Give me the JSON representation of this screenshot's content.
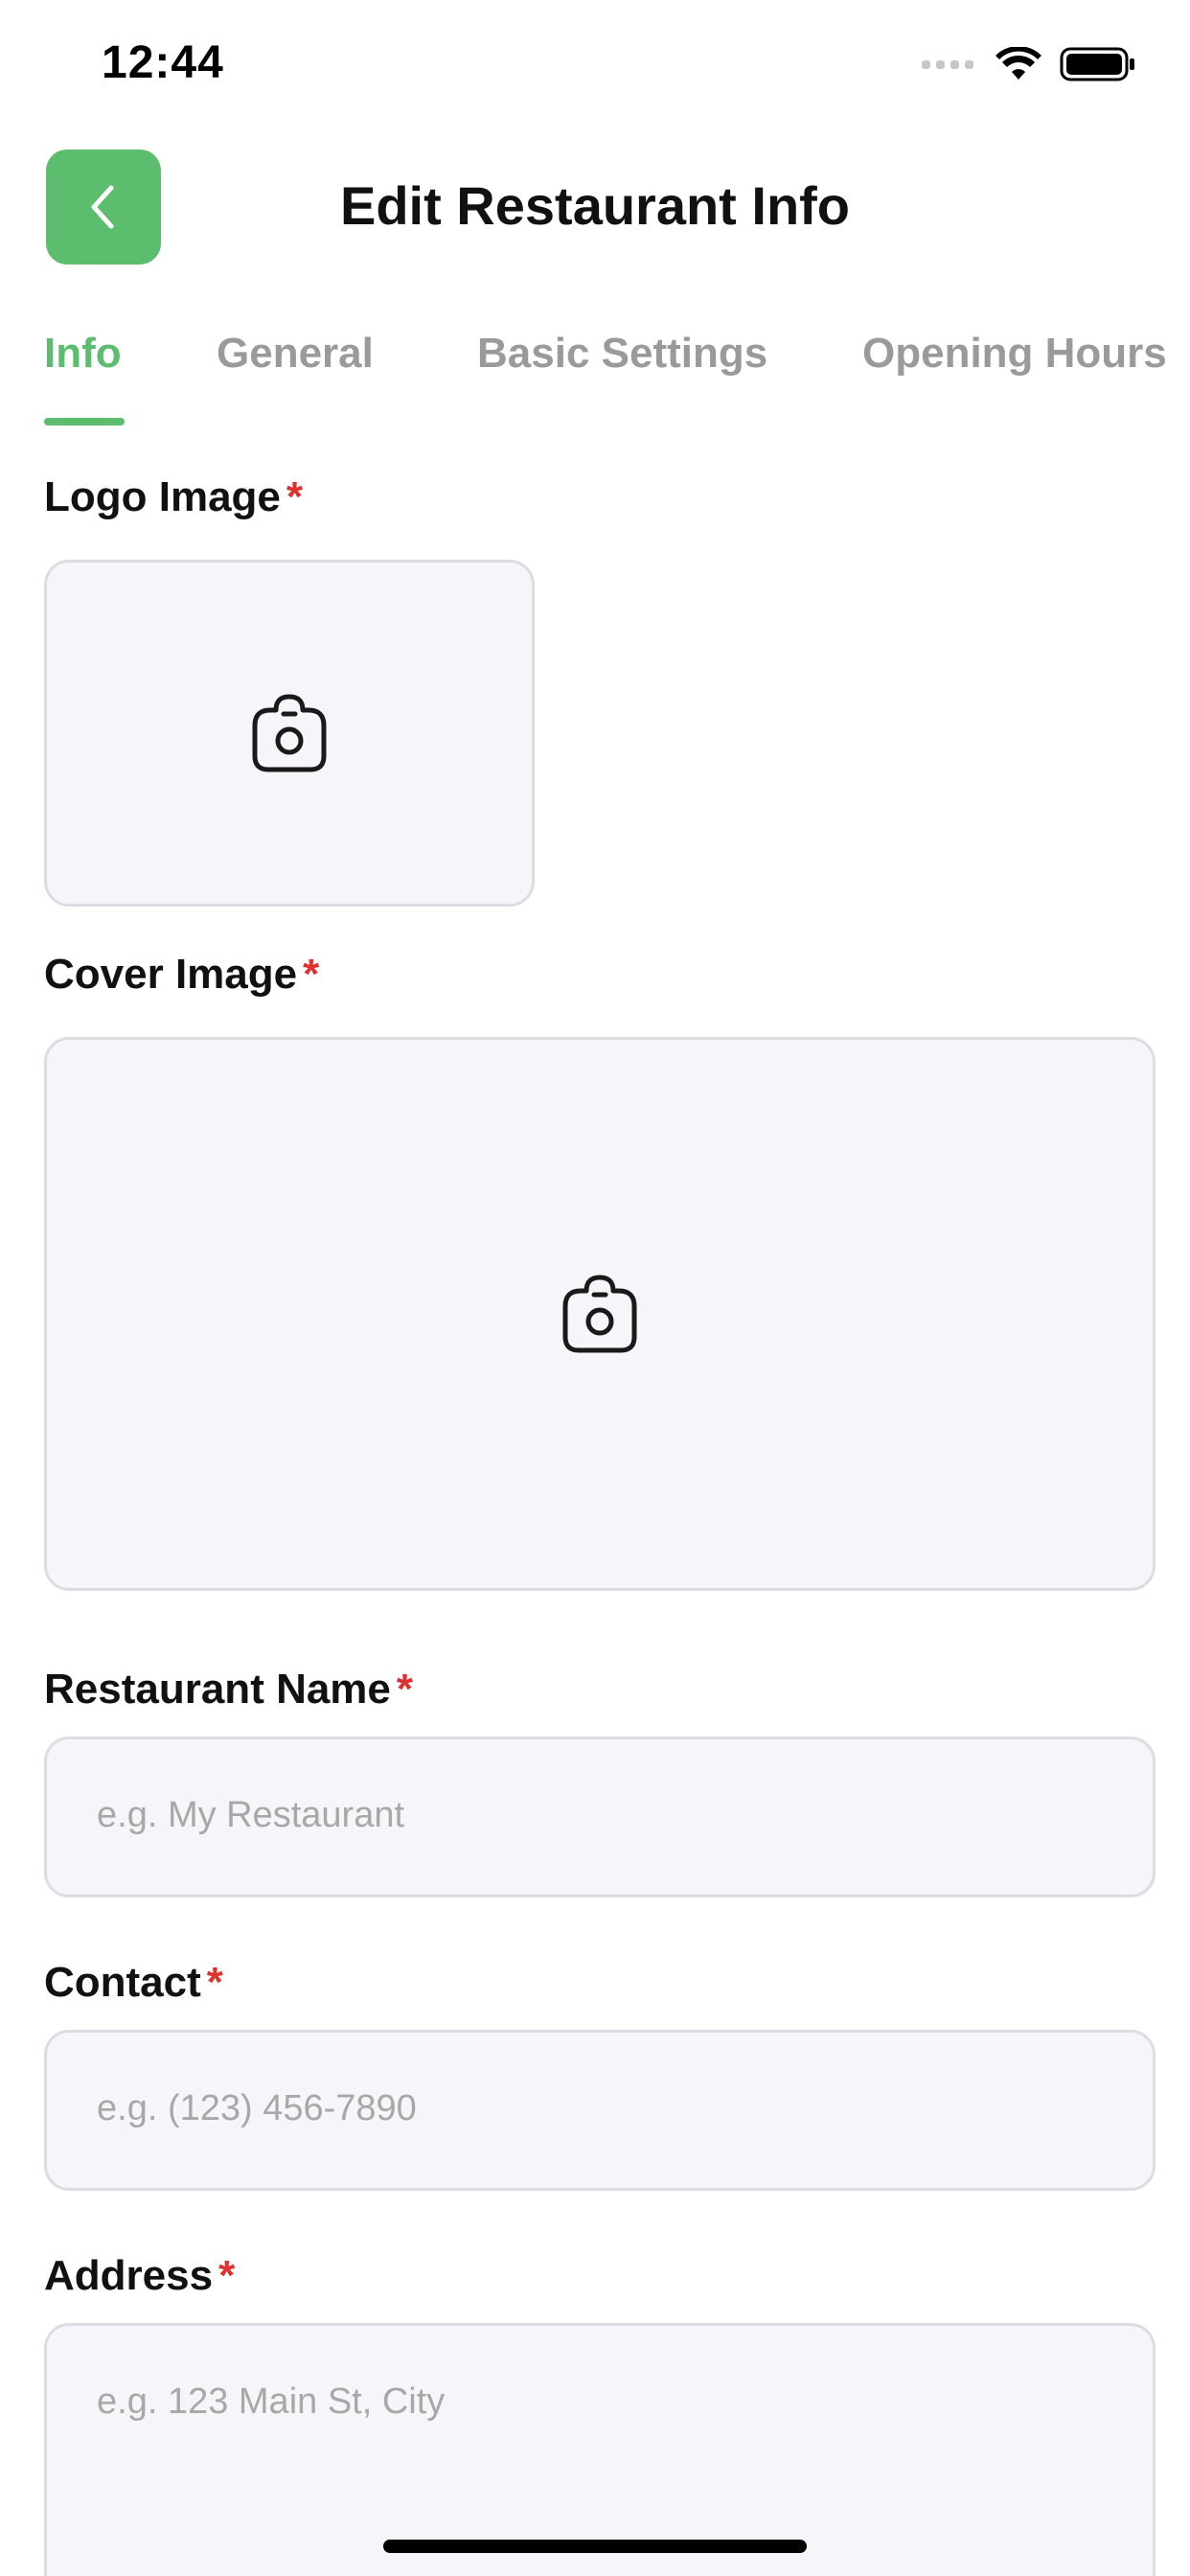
{
  "status_bar": {
    "time": "12:44",
    "icons": [
      "signal-icon",
      "wifi-icon",
      "battery-icon"
    ]
  },
  "header": {
    "title": "Edit Restaurant Info",
    "back_icon": "chevron-left-icon"
  },
  "tabs": [
    {
      "label": "Info",
      "active": true
    },
    {
      "label": "General",
      "active": false
    },
    {
      "label": "Basic Settings",
      "active": false
    },
    {
      "label": "Opening Hours",
      "active": false
    }
  ],
  "form": {
    "required_mark": "*",
    "logo_image": {
      "label": "Logo Image",
      "icon": "camera-icon"
    },
    "cover_image": {
      "label": "Cover Image",
      "icon": "camera-icon"
    },
    "restaurant_name": {
      "label": "Restaurant Name",
      "value": "",
      "placeholder": "e.g. My Restaurant"
    },
    "contact": {
      "label": "Contact",
      "value": "",
      "placeholder": "e.g. (123) 456-7890"
    },
    "address": {
      "label": "Address",
      "value": "",
      "placeholder": "e.g. 123 Main St, City"
    }
  },
  "colors": {
    "accent": "#5dbd6f",
    "required": "#e03131",
    "field_bg": "#f5f6fa",
    "inactive_tab": "#9a9a9a"
  }
}
